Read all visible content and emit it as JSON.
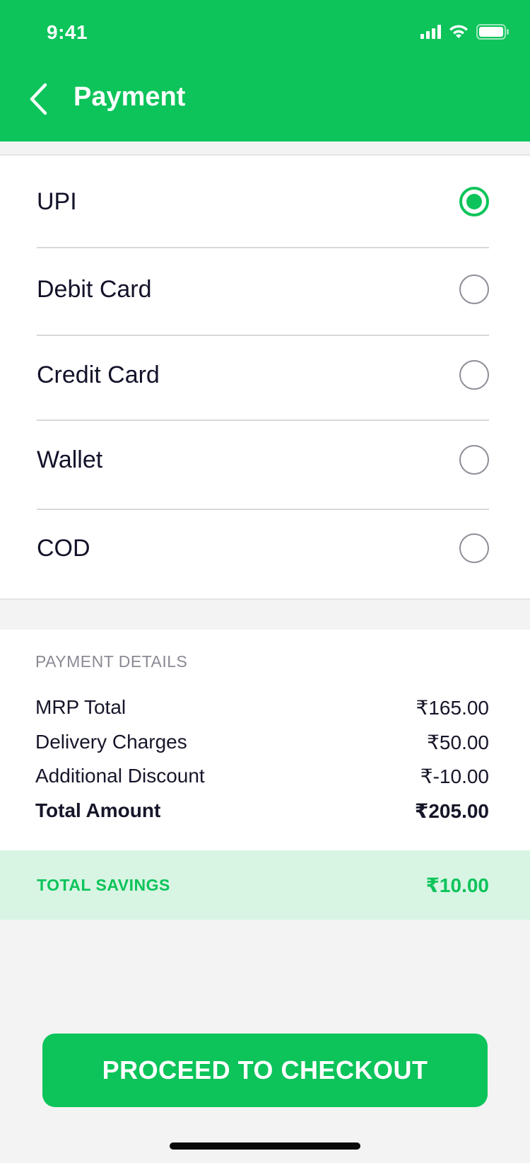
{
  "status_bar": {
    "time": "9:41"
  },
  "header": {
    "title": "Payment",
    "back_icon": "chevron-left-icon"
  },
  "payment_options": [
    {
      "label": "UPI",
      "selected": true
    },
    {
      "label": "Debit Card",
      "selected": false
    },
    {
      "label": "Credit Card",
      "selected": false
    },
    {
      "label": "Wallet",
      "selected": false
    },
    {
      "label": "COD",
      "selected": false
    }
  ],
  "payment_details": {
    "heading": "PAYMENT DETAILS",
    "rows": [
      {
        "label": "MRP Total",
        "value": "₹165.00"
      },
      {
        "label": "Delivery Charges",
        "value": "₹50.00"
      },
      {
        "label": "Additional Discount",
        "value": "₹-10.00"
      },
      {
        "label": "Total Amount",
        "value": "₹205.00"
      }
    ]
  },
  "savings": {
    "label": "TOTAL SAVINGS",
    "value": "₹10.00"
  },
  "checkout_button": {
    "label": "PROCEED TO CHECKOUT"
  },
  "colors": {
    "accent": "#0cc45a",
    "savings_background": "#d8f5e4",
    "text_primary": "#12122a",
    "text_muted": "#8a8a95"
  }
}
